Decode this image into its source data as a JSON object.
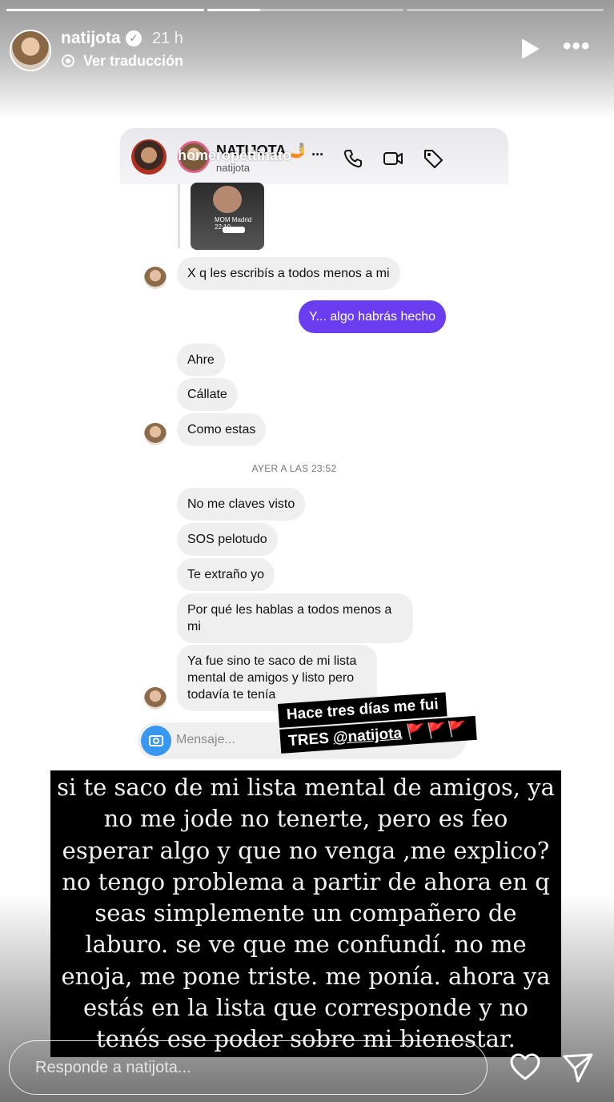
{
  "story": {
    "progress": [
      1.0,
      0.27,
      0.0
    ],
    "author": "natijota",
    "verified_mark": "✓",
    "time": "21 h",
    "translate_label": "Ver traducción",
    "icons": {
      "play": "play-icon",
      "more": "more-icon",
      "translate": "translate-icon"
    }
  },
  "dm_screenshot": {
    "overlay_name": "homeropettinato",
    "chat_title": "NATIJOTA 🤳 ...",
    "chat_subtitle": "natijota",
    "shared_post_tag": "MOM   Madrid 22:10",
    "messages": [
      {
        "text": "X q les escribís a todos menos a mi",
        "from": "them"
      },
      {
        "text": "Y... algo habrás hecho",
        "from": "me"
      },
      {
        "text": "Ahre",
        "from": "them"
      },
      {
        "text": "Cállate",
        "from": "them"
      },
      {
        "text": "Como estas",
        "from": "them"
      },
      {
        "text": "No me claves visto",
        "from": "them"
      },
      {
        "text": "SOS pelotudo",
        "from": "them"
      },
      {
        "text": "Te extraño yo",
        "from": "them"
      },
      {
        "text": "Por qué les hablas a todos menos a mi",
        "from": "them"
      },
      {
        "text": "Ya fue sino te saco de mi lista mental de amigos y listo pero todavía te tenía",
        "from": "them"
      }
    ],
    "timestamp": "AYER A LAS 23:52",
    "composer_placeholder": "Mensaje..."
  },
  "sticker": {
    "line1": "Hace tres días me fui",
    "line2_prefix": "TRES ",
    "mention": "@natijota",
    "flags": "🚩🚩🚩"
  },
  "caption": "si te saco de mi lista mental de amigos, ya no me jode no tenerte, pero es feo esperar algo y que no venga ,me explico? no tengo problema a partir de ahora en q seas simplemente un compañero de laburo. se ve que me confundí. no me enoja, me pone triste. me ponía. ahora ya estás en la lista que corresponde y no tenés ese poder sobre mi bienestar.",
  "reply": {
    "placeholder": "Responde a natijota...",
    "icons": {
      "heart": "heart-icon",
      "send": "send-icon"
    }
  },
  "colors": {
    "my_bubble": "#6a3ef0",
    "their_bubble": "#efefef",
    "camera_button": "#3897f0",
    "flag_red": "#e53a2d"
  }
}
